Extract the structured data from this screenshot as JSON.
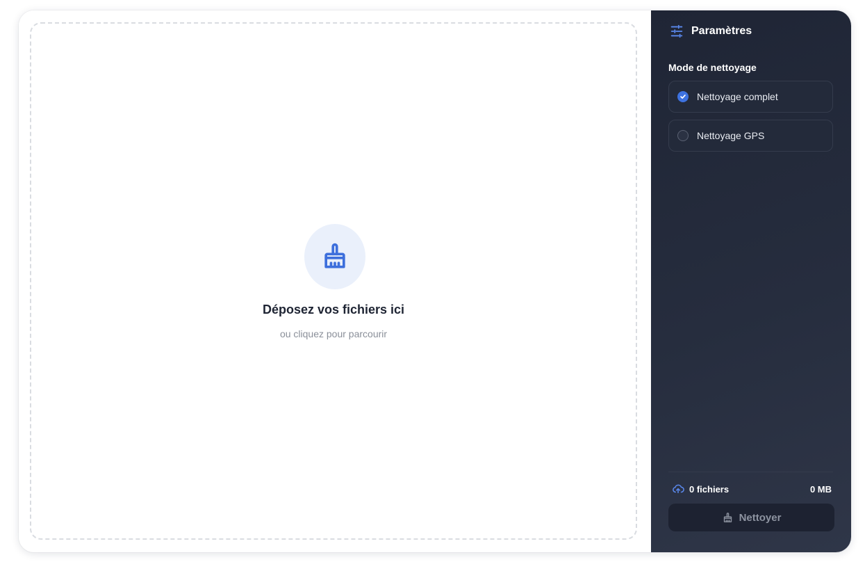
{
  "dropzone": {
    "title": "Déposez vos fichiers ici",
    "subtitle": "ou cliquez pour parcourir"
  },
  "sidebar": {
    "title": "Paramètres",
    "mode_label": "Mode de nettoyage",
    "options": [
      {
        "label": "Nettoyage complet",
        "selected": true
      },
      {
        "label": "Nettoyage GPS",
        "selected": false
      }
    ],
    "stats": {
      "files": "0 fichiers",
      "size": "0 MB"
    },
    "clean_button_label": "Nettoyer"
  },
  "colors": {
    "accent": "#3d72e0",
    "sidebar_bg": "#1f2535",
    "dropzone_border": "#d9dce1"
  },
  "icons": {
    "header": "sliders-icon",
    "dropzone": "broom-icon",
    "stats": "cloud-upload-icon",
    "button": "broom-icon"
  }
}
